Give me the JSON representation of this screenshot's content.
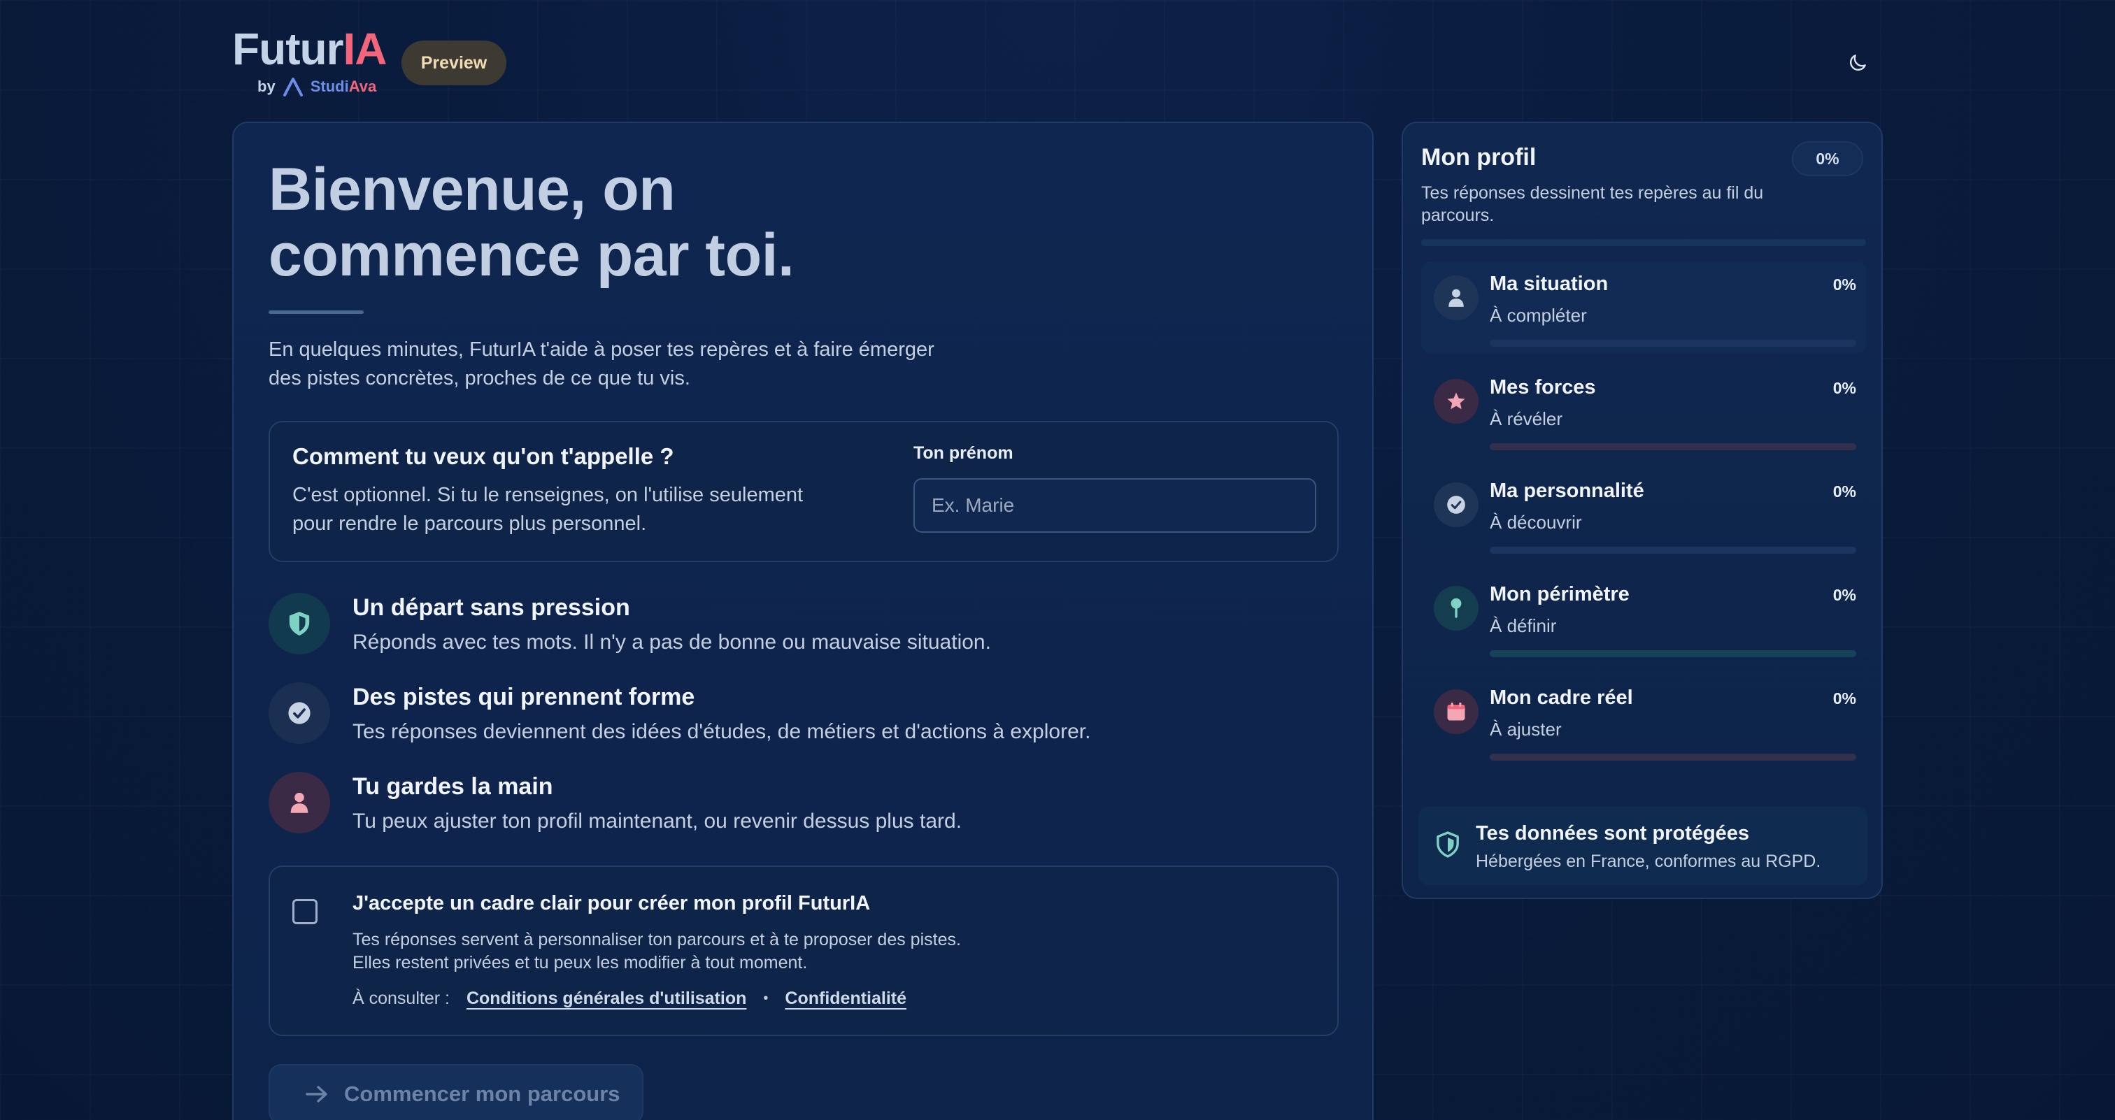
{
  "header": {
    "logo_part1": "Futur",
    "logo_part2": "IA",
    "by_label": "by",
    "studiava_part1": "Studi",
    "studiava_part2": "Ava",
    "preview_badge": "Preview",
    "theme_icon": "moon-icon"
  },
  "hero": {
    "title_line1": "Bienvenue, on",
    "title_line2": "commence par toi.",
    "subtitle": "En quelques minutes, FuturIA t'aide à poser tes repères et à faire émerger des pistes concrètes, proches de ce que tu vis."
  },
  "name_section": {
    "question": "Comment tu veux qu'on t'appelle ?",
    "description": "C'est optionnel. Si tu le renseignes, on l'utilise seulement pour rendre le parcours plus personnel.",
    "field_label": "Ton prénom",
    "placeholder": "Ex. Marie",
    "value": ""
  },
  "features": [
    {
      "icon": "shield-icon",
      "title": "Un départ sans pression",
      "description": "Réponds avec tes mots. Il n'y a pas de bonne ou mauvaise situation."
    },
    {
      "icon": "check-circle-icon",
      "title": "Des pistes qui prennent forme",
      "description": "Tes réponses deviennent des idées d'études, de métiers et d'actions à explorer."
    },
    {
      "icon": "user-icon",
      "title": "Tu gardes la main",
      "description": "Tu peux ajuster ton profil maintenant, ou revenir dessus plus tard."
    }
  ],
  "consent": {
    "title": "J'accepte un cadre clair pour créer mon profil FuturIA",
    "text_line1": "Tes réponses servent à personnaliser ton parcours et à te proposer des pistes.",
    "text_line2": "Elles restent privées et tu peux les modifier à tout moment.",
    "links_prefix": "À consulter :",
    "link_terms": "Conditions générales d'utilisation",
    "separator": "•",
    "link_privacy": "Confidentialité",
    "checked": false
  },
  "start_button": {
    "label": "Commencer mon parcours",
    "icon": "arrow-right-icon"
  },
  "profile": {
    "title": "Mon profil",
    "overall_pct": "0%",
    "subtitle": "Tes réponses dessinent tes repères au fil du parcours.",
    "items": [
      {
        "icon": "user-icon",
        "title": "Ma situation",
        "status": "À compléter",
        "pct": "0%",
        "progress": 0
      },
      {
        "icon": "star-icon",
        "title": "Mes forces",
        "status": "À révéler",
        "pct": "0%",
        "progress": 0
      },
      {
        "icon": "check-circle-icon",
        "title": "Ma personnalité",
        "status": "À découvrir",
        "pct": "0%",
        "progress": 0
      },
      {
        "icon": "location-pin-icon",
        "title": "Mon périmètre",
        "status": "À définir",
        "pct": "0%",
        "progress": 0
      },
      {
        "icon": "calendar-icon",
        "title": "Mon cadre réel",
        "status": "À ajuster",
        "pct": "0%",
        "progress": 0
      }
    ],
    "data_notice": {
      "icon": "shield-icon",
      "title": "Tes données sont protégées",
      "text": "Hébergées en France, conformes au RGPD."
    }
  },
  "colors": {
    "accent_red": "#f2657a",
    "accent_blue": "#6c8ee8",
    "background": "#0a1c3e",
    "teal": "#7fd1c4"
  }
}
